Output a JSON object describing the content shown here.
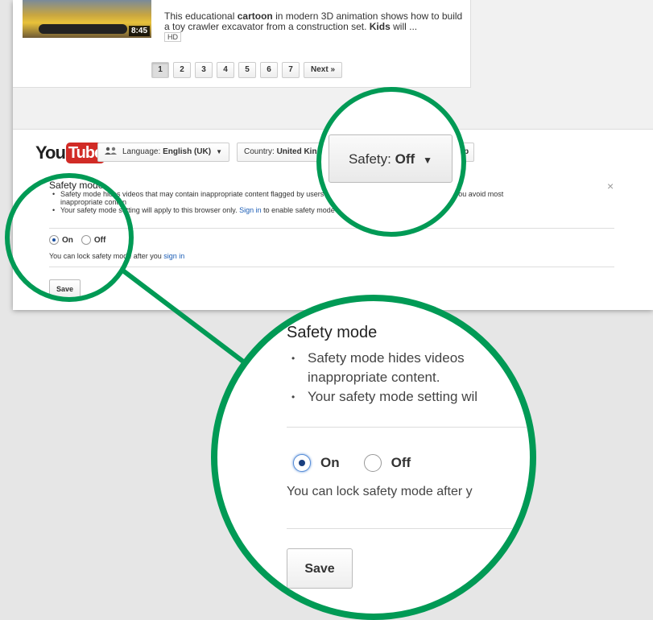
{
  "results": {
    "description_prefix": "This educational ",
    "description_bold1": "cartoon",
    "description_mid": " in modern 3D animation shows how to build a toy crawler excavator from a construction set. ",
    "description_bold2": "Kids",
    "description_suffix": " will ...",
    "hd_badge": "HD",
    "duration": "8:45",
    "pages": [
      "1",
      "2",
      "3",
      "4",
      "5",
      "6",
      "7"
    ],
    "current_page": "1",
    "next_label": "Next »"
  },
  "footer": {
    "logo_you": "You",
    "logo_tube": "Tube",
    "language_label": "Language: ",
    "language_value": "English (UK)",
    "country_label": "Country: ",
    "country_value": "United Kingd",
    "help_fragment": "p",
    "close_symbol": "×"
  },
  "safety_panel": {
    "title": "Safety mode",
    "bullet1_a": "Safety mode hides ",
    "bullet1_b": "videos that may contain inappropriate content flagged by users a",
    "bullet1_c": "rate, but it should help you avoid most",
    "bullet1_d": "inappropriate conten",
    "bullet2_a": "Your safety mode sett",
    "bullet2_b": "ing will apply to this browser only. ",
    "sign_in_link": "Sign in",
    "bullet2_c": " to enable safety mode eve",
    "on_label": "On",
    "off_label": "Off",
    "lock_note": "You can lock safety mode after you ",
    "lock_link": "sign in",
    "save_label": "Save"
  },
  "safety_zoom": {
    "label": "Safety: ",
    "value": "Off"
  },
  "big_zoom": {
    "title": "Safety mode",
    "bullet1_line1": "Safety mode hides videos",
    "bullet1_line2": "inappropriate content.",
    "bullet2": "Your safety mode setting wil",
    "on_label": "On",
    "off_label": "Off",
    "note": "You can lock safety mode after y",
    "save_label": "Save"
  },
  "colors": {
    "ring": "#009a55",
    "youtube_red": "#d12b26",
    "link": "#1a5cb5"
  }
}
